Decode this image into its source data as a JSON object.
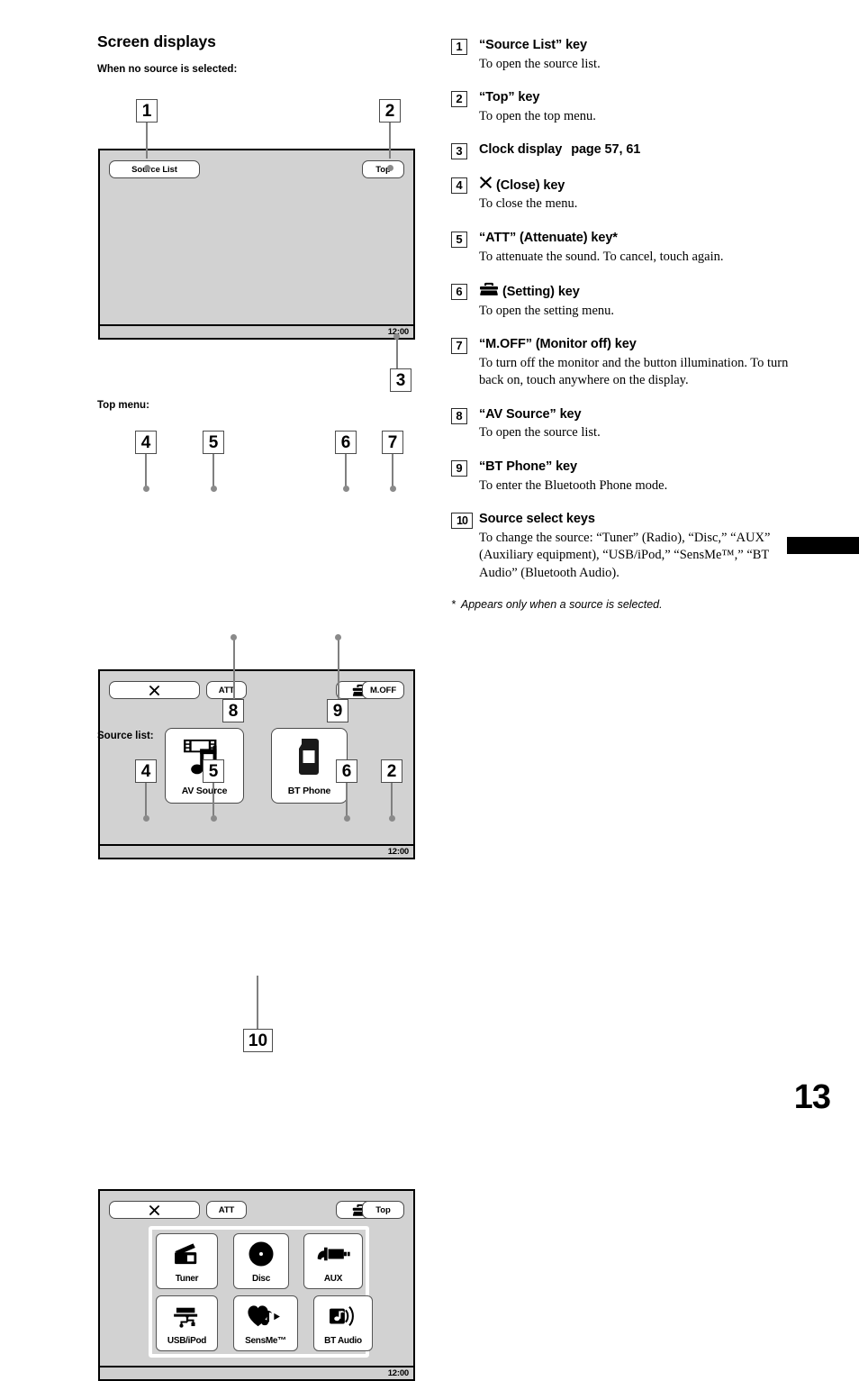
{
  "page": {
    "number": "13",
    "heading": "Screen displays"
  },
  "diagrams": {
    "no_source": {
      "caption": "When no source is selected:",
      "source_list_key": "Source List",
      "top_key": "Top",
      "clock": "12:00",
      "callouts": {
        "source_list": "1",
        "top": "2",
        "clock": "3"
      }
    },
    "top_menu": {
      "caption": "Top menu:",
      "close_key": "✕",
      "att_key": "ATT",
      "setting_key": "setting-toolbox-icon",
      "moff_key": "M.OFF",
      "tiles": [
        {
          "label": "AV Source",
          "icon": "film-music-note-icon"
        },
        {
          "label": "BT Phone",
          "icon": "mobile-phone-icon"
        }
      ],
      "clock": "12:00",
      "callouts": {
        "close": "4",
        "att": "5",
        "setting": "6",
        "moff": "7",
        "av_source": "8",
        "bt_phone": "9"
      }
    },
    "source_list": {
      "caption": "Source list:",
      "close_key": "✕",
      "att_key": "ATT",
      "setting_key": "setting-toolbox-icon",
      "top_key": "Top",
      "sources": [
        {
          "label": "Tuner",
          "icon": "radio-icon"
        },
        {
          "label": "Disc",
          "icon": "disc-icon"
        },
        {
          "label": "AUX",
          "icon": "aux-plug-icon"
        },
        {
          "label": "USB/iPod",
          "icon": "usb-icon"
        },
        {
          "label": "SensMe™",
          "icon": "heart-note-icon"
        },
        {
          "label": "BT Audio",
          "icon": "bt-audio-icon"
        }
      ],
      "clock": "12:00",
      "callouts": {
        "close": "4",
        "att": "5",
        "setting": "6",
        "top": "2",
        "source_select": "10"
      }
    }
  },
  "legend": [
    {
      "num": "1",
      "head": "“Source List” key",
      "desc": "To open the source list."
    },
    {
      "num": "2",
      "head": "“Top” key",
      "desc": "To open the top menu."
    },
    {
      "num": "3",
      "head": "Clock display",
      "pageref": "page 57, 61",
      "desc": ""
    },
    {
      "num": "4",
      "head": "(Close) key",
      "icon": "close-x-icon",
      "desc": "To close the menu."
    },
    {
      "num": "5",
      "head": "“ATT” (Attenuate) key*",
      "desc": "To attenuate the sound. To cancel, touch again."
    },
    {
      "num": "6",
      "head": "(Setting) key",
      "icon": "setting-toolbox-icon",
      "desc": "To open the setting menu."
    },
    {
      "num": "7",
      "head": "“M.OFF” (Monitor off) key",
      "desc": "To turn off the monitor and the button illumination. To turn back on, touch anywhere on the display."
    },
    {
      "num": "8",
      "head": "“AV Source” key",
      "desc": "To open the source list."
    },
    {
      "num": "9",
      "head": "“BT Phone” key",
      "desc": "To enter the Bluetooth Phone mode."
    },
    {
      "num": "10",
      "head": "Source select keys",
      "desc": "To change the source: “Tuner” (Radio), “Disc,” “AUX” (Auxiliary equipment), “USB/iPod,” “SensMe™,” “BT Audio” (Bluetooth Audio)."
    }
  ],
  "footnote": {
    "marker": "*",
    "text": "Appears only when a source is selected."
  },
  "colors": {
    "screen_bg": "#d2d2d2",
    "leader": "#808080",
    "ink": "#000000"
  }
}
